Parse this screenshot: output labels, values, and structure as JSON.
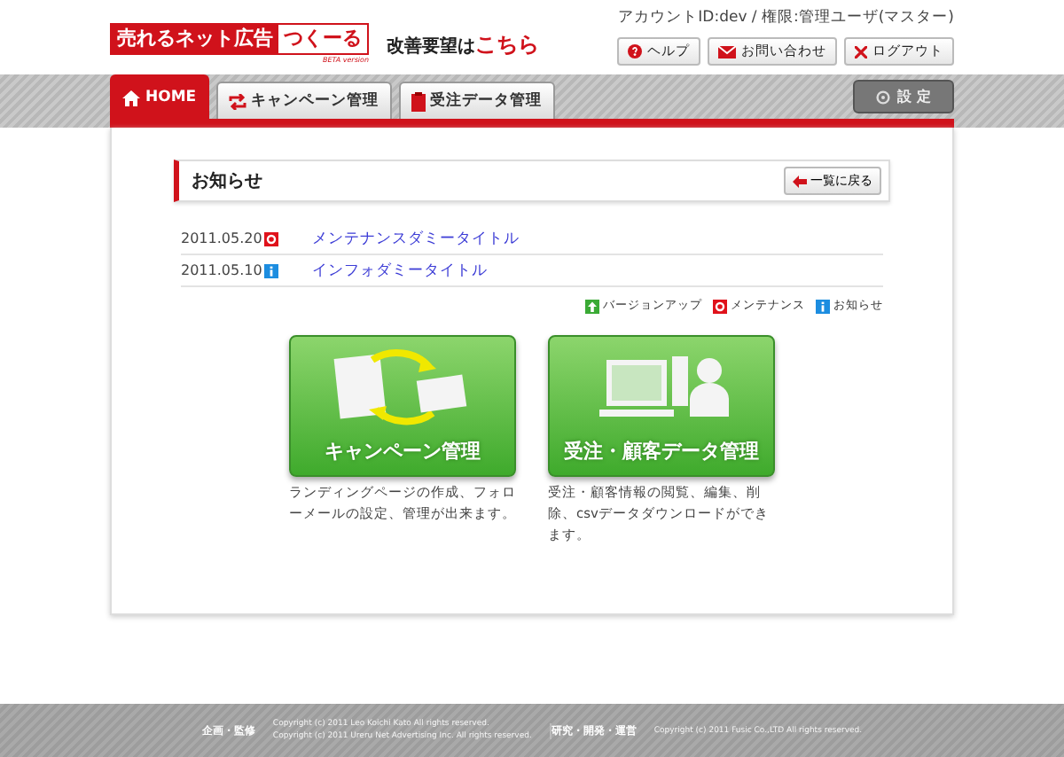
{
  "logo": {
    "main": "売れるネット広告",
    "accent": "つくーる",
    "sub": "BETA version"
  },
  "feedback": {
    "text": "改善要望は",
    "link": "こちら"
  },
  "account": "アカウントID:dev / 権限:管理ユーザ(マスター)",
  "header_buttons": [
    {
      "kind": "help",
      "label": "ヘルプ"
    },
    {
      "kind": "mail",
      "label": "お問い合わせ"
    },
    {
      "kind": "logout",
      "label": "ログアウト"
    }
  ],
  "tabs": [
    {
      "kind": "home",
      "label": "HOME",
      "selected": true
    },
    {
      "kind": "campaign",
      "label": "キャンペーン管理",
      "selected": false
    },
    {
      "kind": "order",
      "label": "受注データ管理",
      "selected": false
    }
  ],
  "settings_button": "設 定",
  "notice": {
    "title": "お知らせ",
    "back_button": "一覧に戻る",
    "items": [
      {
        "date": "2011.05.20",
        "kind": "maintenance",
        "title": "メンテナンスダミータイトル"
      },
      {
        "date": "2011.05.10",
        "kind": "info",
        "title": "インフォダミータイトル"
      }
    ],
    "legend": [
      {
        "kind": "version",
        "label": "バージョンアップ"
      },
      {
        "kind": "maintenance",
        "label": "メンテナンス"
      },
      {
        "kind": "info",
        "label": "お知らせ"
      }
    ]
  },
  "tiles": [
    {
      "kind": "campaign",
      "title": "キャンペーン管理",
      "description": "ランディングページの作成、フォローメールの設定、管理が出来ます。"
    },
    {
      "kind": "order",
      "title": "受注・顧客データ管理",
      "description": "受注・顧客情報の閲覧、編集、削除、csvデータダウンロードができます。"
    }
  ],
  "footer": [
    {
      "role": "企画・監修",
      "lines": [
        "Copyright (c) 2011 Leo Koichi Kato All rights reserved.",
        "Copyright (c) 2011 Ureru Net Advertising Inc. All rights reserved."
      ]
    },
    {
      "role": "研究・開発・運営",
      "lines": [
        "Copyright (c) 2011 Fusic Co.,LTD All rights reserved."
      ]
    }
  ]
}
